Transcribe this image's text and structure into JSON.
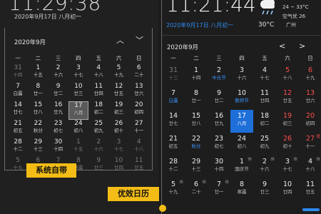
{
  "left": {
    "time": "11:29:38",
    "date": "2020年9月17日 八月初一",
    "month": "2020年9月",
    "nav_up": "︿",
    "nav_down": "﹀",
    "weekdays": [
      "一",
      "二",
      "三",
      "四",
      "五",
      "六",
      "日"
    ],
    "rows": [
      [
        {
          "n": "31",
          "l": "十四",
          "dim": true
        },
        {
          "n": "1",
          "l": "十五"
        },
        {
          "n": "2",
          "l": "十六"
        },
        {
          "n": "3",
          "l": "十七"
        },
        {
          "n": "4",
          "l": "十八"
        },
        {
          "n": "5",
          "l": "十九"
        },
        {
          "n": "6",
          "l": "二十"
        }
      ],
      [
        {
          "n": "7",
          "l": "白露"
        },
        {
          "n": "8",
          "l": "廿一"
        },
        {
          "n": "9",
          "l": "廿二"
        },
        {
          "n": "10",
          "l": "廿三"
        },
        {
          "n": "11",
          "l": "廿四"
        },
        {
          "n": "12",
          "l": "廿五"
        },
        {
          "n": "13",
          "l": "廿六"
        }
      ],
      [
        {
          "n": "14",
          "l": "廿七"
        },
        {
          "n": "15",
          "l": "廿八"
        },
        {
          "n": "16",
          "l": "廿九"
        },
        {
          "n": "17",
          "l": "八月",
          "today": true
        },
        {
          "n": "18",
          "l": "初二"
        },
        {
          "n": "19",
          "l": "初三"
        },
        {
          "n": "20",
          "l": "初四"
        }
      ],
      [
        {
          "n": "21",
          "l": "初五"
        },
        {
          "n": "22",
          "l": "秋分"
        },
        {
          "n": "23",
          "l": "初七"
        },
        {
          "n": "24",
          "l": "初八"
        },
        {
          "n": "25",
          "l": "初九"
        },
        {
          "n": "26",
          "l": "初十"
        },
        {
          "n": "27",
          "l": "十一"
        }
      ],
      [
        {
          "n": "28",
          "l": "十二"
        },
        {
          "n": "29",
          "l": "十三"
        },
        {
          "n": "30",
          "l": "十四"
        },
        {
          "n": "1",
          "l": "十五",
          "dim": true
        },
        {
          "n": "2",
          "l": "十六",
          "dim": true
        },
        {
          "n": "3",
          "l": "十七",
          "dim": true
        },
        {
          "n": "4",
          "l": "十八",
          "dim": true
        }
      ],
      [
        {
          "n": "5",
          "l": "十九",
          "dim": true
        },
        {
          "n": "6",
          "l": "二十",
          "dim": true
        },
        {
          "n": "7",
          "l": "廿一",
          "dim": true
        },
        {
          "n": "8",
          "l": "寒露",
          "dim": true
        },
        {
          "n": "9",
          "l": "廿三",
          "dim": true
        },
        {
          "n": "10",
          "l": "廿四",
          "dim": true
        },
        {
          "n": "11",
          "l": "廿五",
          "dim": true
        }
      ]
    ],
    "badge": "系统自带"
  },
  "right": {
    "time": "11:21:44",
    "date": "2020年9月17日 八月初一",
    "weather_icon": "rain-cloud-icon",
    "temp_range": "24 ~ 33°C",
    "aqi": "空气优 26",
    "temp": "30°C",
    "city": "广州",
    "month": "2020年9月",
    "nav_prev": "<",
    "nav_next": ">",
    "weekdays": [
      "一",
      "二",
      "三",
      "四",
      "五",
      "六",
      "日"
    ],
    "rows": [
      [
        {
          "n": "31",
          "l": "十三",
          "dim": true
        },
        {
          "n": "1",
          "l": "十四"
        },
        {
          "n": "2",
          "l": "中元节",
          "blue": true
        },
        {
          "n": "3",
          "l": "十六"
        },
        {
          "n": "4",
          "l": "十七"
        },
        {
          "n": "5",
          "l": "十八",
          "red": true
        },
        {
          "n": "6",
          "l": "十九",
          "red": true
        }
      ],
      [
        {
          "n": "7",
          "l": "白露",
          "blue": true
        },
        {
          "n": "8",
          "l": "廿一"
        },
        {
          "n": "9",
          "l": "廿二"
        },
        {
          "n": "10",
          "l": "教师节",
          "blue": true
        },
        {
          "n": "11",
          "l": "廿四"
        },
        {
          "n": "12",
          "l": "廿五",
          "red": true
        },
        {
          "n": "13",
          "l": "廿六",
          "red": true
        }
      ],
      [
        {
          "n": "14",
          "l": "廿七"
        },
        {
          "n": "15",
          "l": "廿八"
        },
        {
          "n": "16",
          "l": "廿九"
        },
        {
          "n": "17",
          "l": "八月",
          "today": true
        },
        {
          "n": "18",
          "l": "初二"
        },
        {
          "n": "19",
          "l": "初三",
          "red": true
        },
        {
          "n": "20",
          "l": "初四",
          "red": true
        }
      ],
      [
        {
          "n": "21",
          "l": "初五"
        },
        {
          "n": "22",
          "l": "秋分",
          "blue": true
        },
        {
          "n": "23",
          "l": "初七"
        },
        {
          "n": "24",
          "l": "初八"
        },
        {
          "n": "25",
          "l": "初九"
        },
        {
          "n": "26",
          "l": "初十",
          "red": true
        },
        {
          "n": "27",
          "l": "十一",
          "red": true,
          "tag": "班"
        }
      ],
      [
        {
          "n": "28",
          "l": "十二"
        },
        {
          "n": "29",
          "l": "十三"
        },
        {
          "n": "30",
          "l": "十四"
        },
        {
          "n": "1",
          "l": "国庆节",
          "tag": "休"
        },
        {
          "n": "2",
          "l": "十六",
          "tag": "休"
        },
        {
          "n": "3",
          "l": "十七",
          "tag": "休"
        },
        {
          "n": "4",
          "l": "十八",
          "tag": "休"
        }
      ],
      [
        {
          "n": "5",
          "l": "十九",
          "tag": "休"
        },
        {
          "n": "6",
          "l": "二十",
          "tag": "休"
        },
        {
          "n": "7",
          "l": "廿一",
          "tag": "休"
        },
        {
          "n": "8",
          "l": "寒露"
        },
        {
          "n": "9",
          "l": "廿三"
        },
        {
          "n": "10",
          "l": "廿四"
        },
        {
          "n": "11",
          "l": "廿五"
        }
      ]
    ],
    "badge": "优效日历"
  }
}
